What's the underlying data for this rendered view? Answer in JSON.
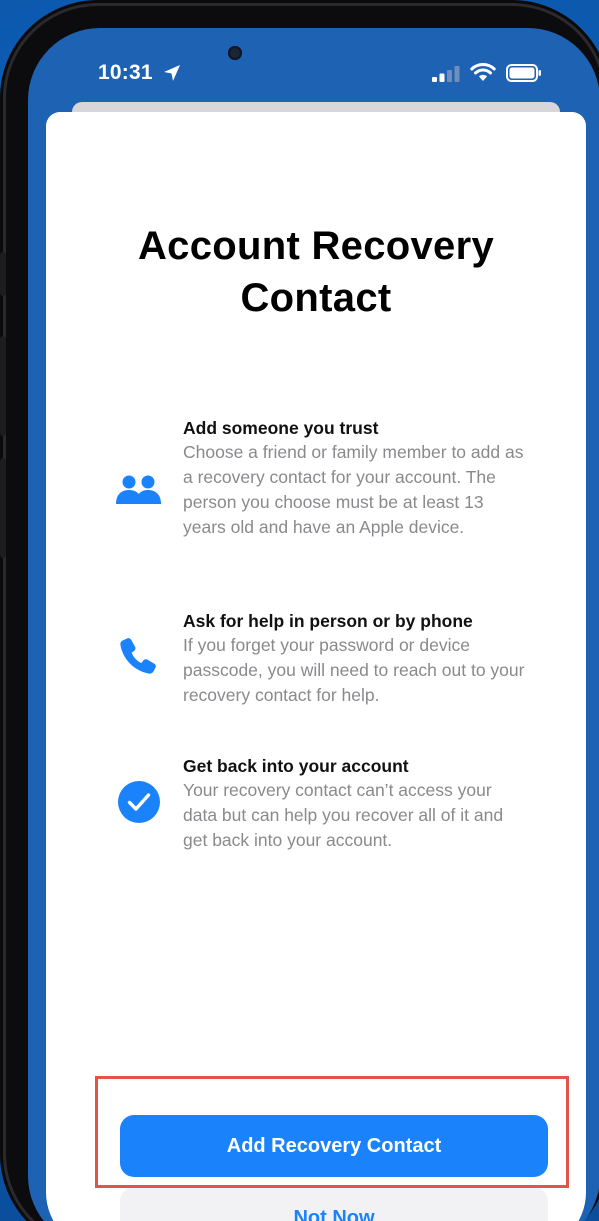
{
  "status_bar": {
    "time": "10:31",
    "location_icon": "location-arrow-icon",
    "signal_icon": "cellular-signal-icon",
    "wifi_icon": "wifi-icon",
    "battery_icon": "battery-icon"
  },
  "sheet": {
    "title_line1": "Account Recovery",
    "title_line2": "Contact",
    "features": [
      {
        "icon": "two-people-icon",
        "heading": "Add someone you trust",
        "body": "Choose a friend or family member to add as a recovery contact for your account. The person you choose must be at least 13 years old and have an Apple device."
      },
      {
        "icon": "phone-icon",
        "heading": "Ask for help in person or by phone",
        "body": "If you forget your password or device passcode, you will need to reach out to your recovery contact for help."
      },
      {
        "icon": "checkmark-circle-icon",
        "heading": "Get back into your account",
        "body": "Your recovery contact can’t access your data but can help you recover all of it and get back into your account."
      }
    ],
    "primary_button": "Add Recovery Contact",
    "secondary_button": "Not Now"
  },
  "colors": {
    "accent": "#1a82fb",
    "highlight": "#e2534b",
    "background": "#1062bd"
  }
}
